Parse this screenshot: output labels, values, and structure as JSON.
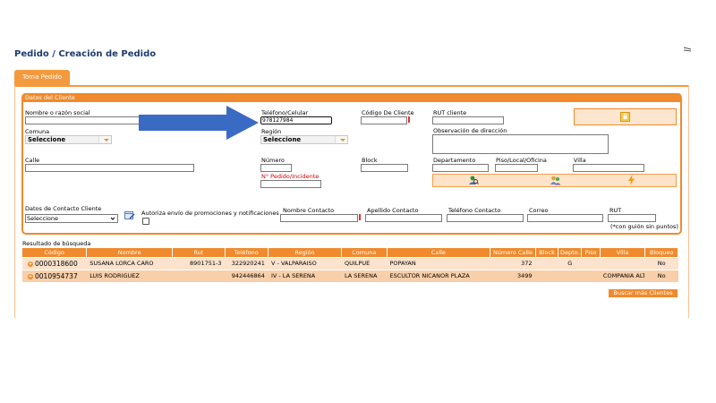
{
  "header": {
    "title": "Pedido / Creación de Pedido"
  },
  "tabs": [
    {
      "label": "Toma Pedido"
    }
  ],
  "panel": {
    "title": "Datos del Cliente"
  },
  "form": {
    "nombre_label": "Nombre o razón social",
    "nombre_value": "",
    "telefono_label": "Teléfono/Celular",
    "telefono_value": "978127984",
    "codigo_label": "Código De Cliente",
    "codigo_value": "",
    "rut_label": "RUT cliente",
    "rut_value": "",
    "comuna_label": "Comuna",
    "comuna_value": "Seleccione",
    "region_label": "Región",
    "region_value": "Seleccione",
    "observacion_label": "Observación de dirección",
    "calle_label": "Calle",
    "numero_label": "Número",
    "block_label": "Block",
    "departamento_label": "Departamento",
    "piso_label": "Piso/Local/Oficina",
    "villa_label": "Villa",
    "pedido_label": "N° Pedido/Incidente"
  },
  "contacto": {
    "datos_label": "Datos de Contacto Cliente",
    "datos_value": "Seleccione",
    "autoriza_label": "Autoriza envío de promociones y notificaciones",
    "nombre_label": "Nombre Contacto",
    "apellido_label": "Apellido Contacto",
    "telefono_label": "Teléfono Contacto",
    "correo_label": "Correo",
    "rut_label": "RUT",
    "rut_hint": "(*con guión sin puntos)"
  },
  "results": {
    "title": "Resultado de búsqueda",
    "columns": [
      "Código",
      "Nombre",
      "Rut",
      "Teléfono",
      "Región",
      "Comuna",
      "Calle",
      "Número Calle",
      "Block",
      "Depto.",
      "Piso",
      "Villa",
      "Bloqueo"
    ],
    "rows": [
      [
        "0000318600",
        "SUSANA LORCA CARO",
        "8901751-3",
        "322920241",
        "V - VALPARAISO",
        "QUILPUE",
        "POPAYAN",
        "372",
        "",
        "G",
        "",
        "",
        "No"
      ],
      [
        "0010954737",
        "LUIS RODRIGUEZ",
        "",
        "942446864",
        "IV - LA SERENA",
        "LA SERENA",
        "ESCULTOR NICANOR PLAZA",
        "3499",
        "",
        "",
        "",
        "COMPANIA ALTA",
        "No"
      ]
    ],
    "more_button": "Buscar más Clientes"
  },
  "colors": {
    "accent": "#f08a2c",
    "title": "#1f3b6f",
    "arrow": "#3a6bc4"
  },
  "icons": [
    "lock-icon",
    "search-person-icon",
    "add-person-icon",
    "lightning-icon",
    "calendar-edit-icon",
    "plus-circle-icon"
  ]
}
